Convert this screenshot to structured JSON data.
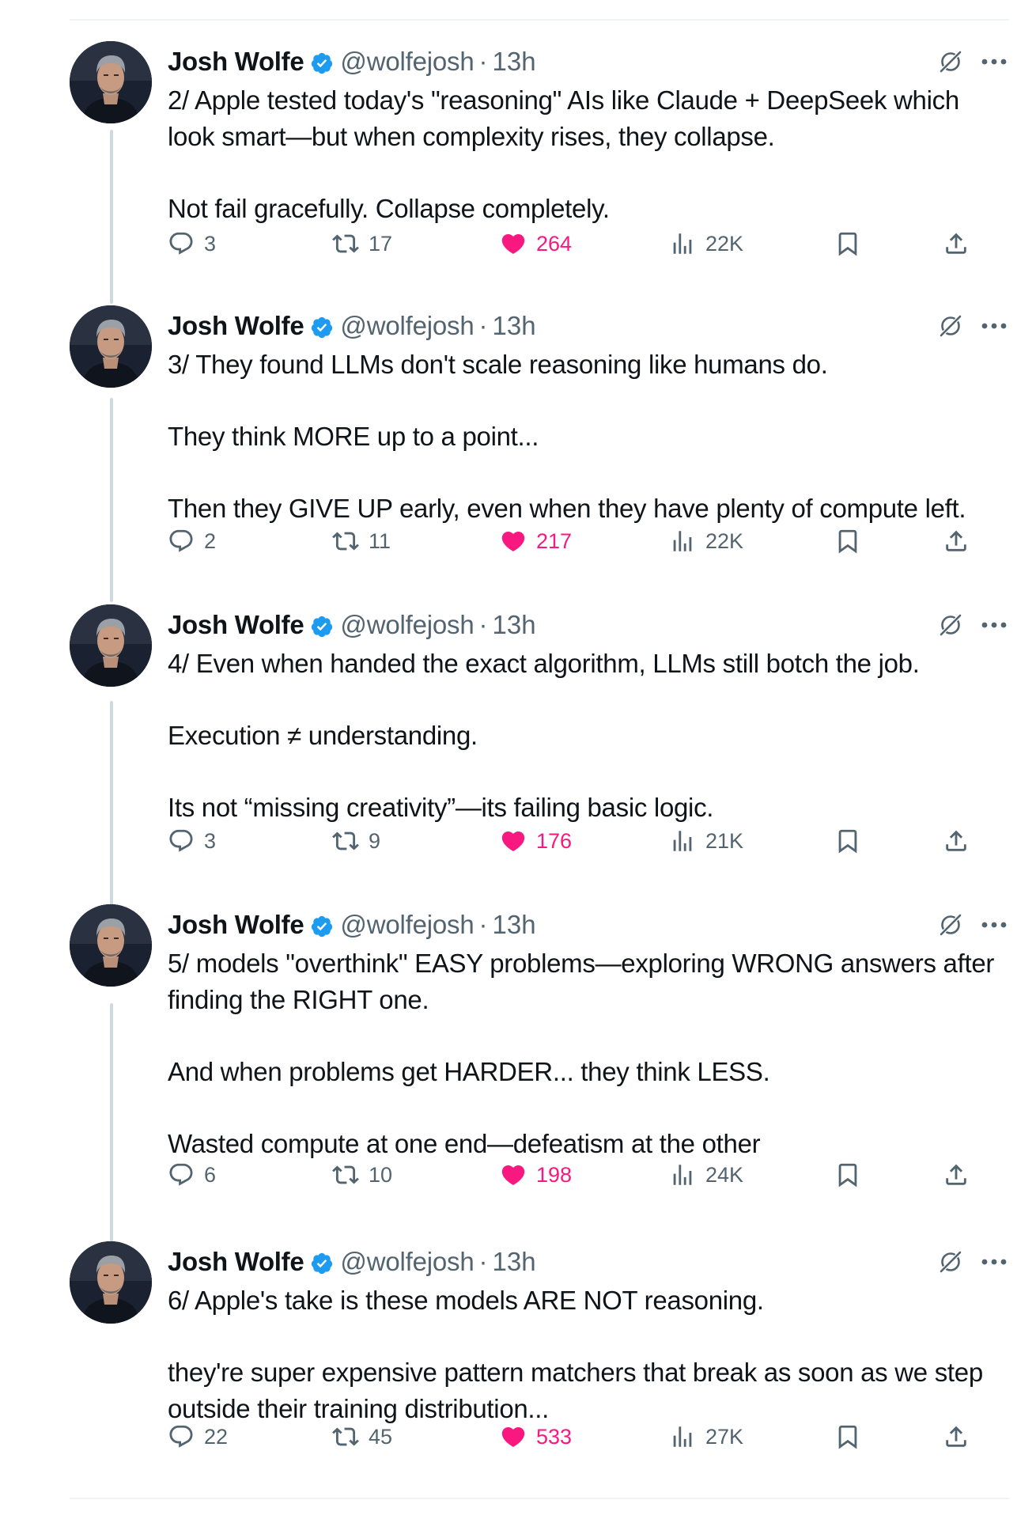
{
  "author": {
    "name": "Josh Wolfe",
    "handle": "@wolfejosh",
    "separator": "·",
    "verified_color": "#1d9bf0"
  },
  "colors": {
    "like": "#f91880",
    "muted": "#536471",
    "thread_line": "#cfd9de"
  },
  "icons": [
    "reply-icon",
    "retweet-icon",
    "heart-icon",
    "views-icon",
    "bookmark-icon",
    "share-icon",
    "grok-icon",
    "more-icon",
    "verified-icon"
  ],
  "tweets": [
    {
      "time": "13h",
      "paragraphs": [
        "2/ Apple tested today's \"reasoning\" AIs like Claude + DeepSeek which look smart—but when complexity rises, they collapse.",
        "Not fail gracefully. Collapse completely."
      ],
      "replies": "3",
      "retweets": "17",
      "likes": "264",
      "views": "22K"
    },
    {
      "time": "13h",
      "paragraphs": [
        "3/ They found LLMs don't scale reasoning like humans do.",
        "They think MORE up to a point...",
        "Then they GIVE UP early, even when they have plenty of compute left."
      ],
      "replies": "2",
      "retweets": "11",
      "likes": "217",
      "views": "22K"
    },
    {
      "time": "13h",
      "paragraphs": [
        "4/ Even when handed the exact algorithm, LLMs still botch the job.",
        "Execution ≠ understanding.",
        "Its not “missing creativity”—its failing basic logic."
      ],
      "replies": "3",
      "retweets": "9",
      "likes": "176",
      "views": "21K"
    },
    {
      "time": "13h",
      "paragraphs": [
        "5/ models \"overthink\" EASY problems—exploring WRONG answers after finding the RIGHT one.",
        "And when problems get HARDER... they think LESS.",
        "Wasted compute at one end—defeatism at the other"
      ],
      "replies": "6",
      "retweets": "10",
      "likes": "198",
      "views": "24K"
    },
    {
      "time": "13h",
      "paragraphs": [
        "6/ Apple's take is these models ARE NOT reasoning.",
        "they're super expensive pattern matchers that break as soon as we step outside their training distribution..."
      ],
      "replies": "22",
      "retweets": "45",
      "likes": "533",
      "views": "27K"
    }
  ]
}
